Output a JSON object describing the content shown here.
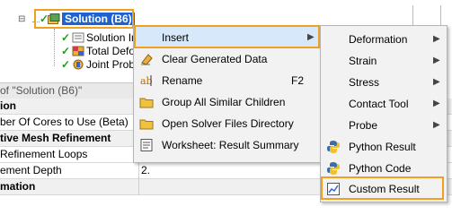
{
  "tree": {
    "solution_label": "Solution (B6)",
    "children": [
      {
        "label": "Solution In"
      },
      {
        "label": "Total Defo"
      },
      {
        "label": "Joint Probe"
      }
    ]
  },
  "details": {
    "header": "of \"Solution (B6)\"",
    "rows": [
      {
        "key": "ion",
        "value": "",
        "bold": true
      },
      {
        "key": "ber Of Cores to Use (Beta)",
        "value": "",
        "bold": false
      },
      {
        "key": "tive Mesh Refinement",
        "value": "",
        "bold": true
      },
      {
        "key": "Refinement Loops",
        "value": "",
        "bold": false
      },
      {
        "key": "ement Depth",
        "value": "2.",
        "bold": false
      },
      {
        "key": "mation",
        "value": "",
        "bold": true
      }
    ]
  },
  "context_menu": {
    "items": [
      {
        "label": "Insert",
        "icon": "none",
        "submenu": true,
        "highlighted": true
      },
      {
        "label": "Clear Generated Data",
        "icon": "eraser-icon"
      },
      {
        "label": "Rename",
        "icon": "rename-icon",
        "shortcut": "F2"
      },
      {
        "label": "Group All Similar Children",
        "icon": "folder-icon"
      },
      {
        "label": "Open Solver Files Directory",
        "icon": "folder-icon"
      },
      {
        "label": "Worksheet: Result Summary",
        "icon": "worksheet-icon"
      }
    ]
  },
  "submenu": {
    "items": [
      {
        "label": "Deformation",
        "submenu": true
      },
      {
        "label": "Strain",
        "submenu": true
      },
      {
        "label": "Stress",
        "submenu": true
      },
      {
        "label": "Contact Tool",
        "submenu": true
      },
      {
        "label": "Probe",
        "submenu": true
      },
      {
        "label": "Python Result",
        "icon": "python-icon"
      },
      {
        "label": "Python Code",
        "icon": "python-icon"
      },
      {
        "label": "Custom Result",
        "icon": "chart-icon"
      }
    ]
  },
  "colors": {
    "highlight": "#d6e8fa",
    "orange_outline": "#f0a020",
    "solution_bg": "#1e62d0"
  }
}
